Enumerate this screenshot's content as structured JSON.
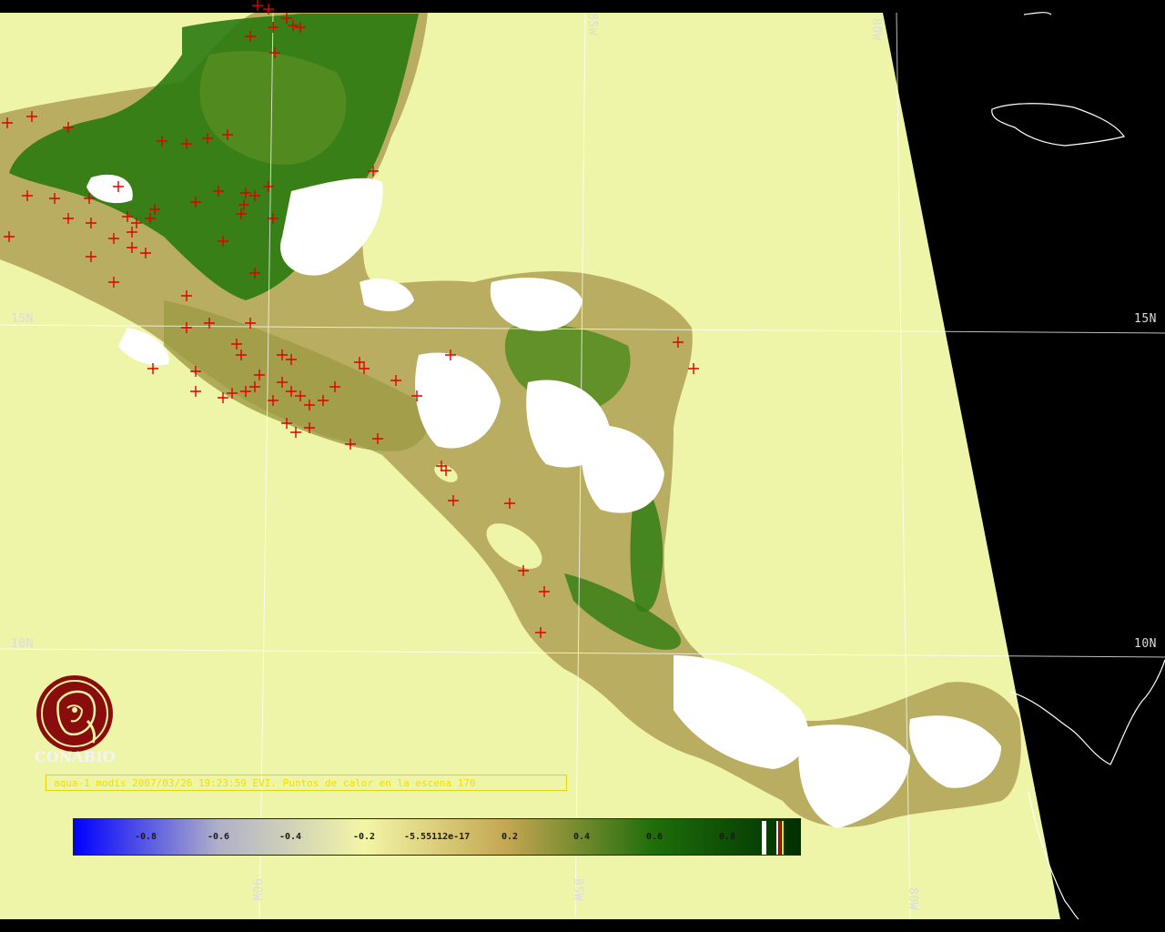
{
  "map": {
    "colors": {
      "ocean": "#eff5a8",
      "background": "#000000",
      "vegetation_dense": "#2a7a10",
      "vegetation_mid": "#8a9a30",
      "vegetation_low": "#c8b86a",
      "cloud": "#ffffff",
      "hotspot": "#e00000",
      "graticule": "#ffffff",
      "coastline": "#ffffff"
    },
    "graticule_labels": {
      "lat_15_left": "15N",
      "lat_15_right": "15N",
      "lat_10_left": "10N",
      "lat_10_right": "10N",
      "lon_85_top": "85W",
      "lon_80_top": "80W",
      "lon_90_bottom": "90W",
      "lon_85_bottom": "85W",
      "lon_80_bottom": "80W"
    },
    "logo_text": "CONABIO",
    "caption": "aqua-1 modis 2007/03/26 19:23:59 EVI. Puntos de calor en la escena 170",
    "colorbar_ticks": [
      "-0.8",
      "-0.6",
      "-0.4",
      "-0.2",
      "-5.55112e-17",
      "0.2",
      "0.4",
      "0.6",
      "0.8"
    ],
    "colorbar_colors": [
      "#0000ff",
      "#b0b0c8",
      "#f3f6a6",
      "#c2a550",
      "#1e6d0a",
      "#003000"
    ]
  }
}
